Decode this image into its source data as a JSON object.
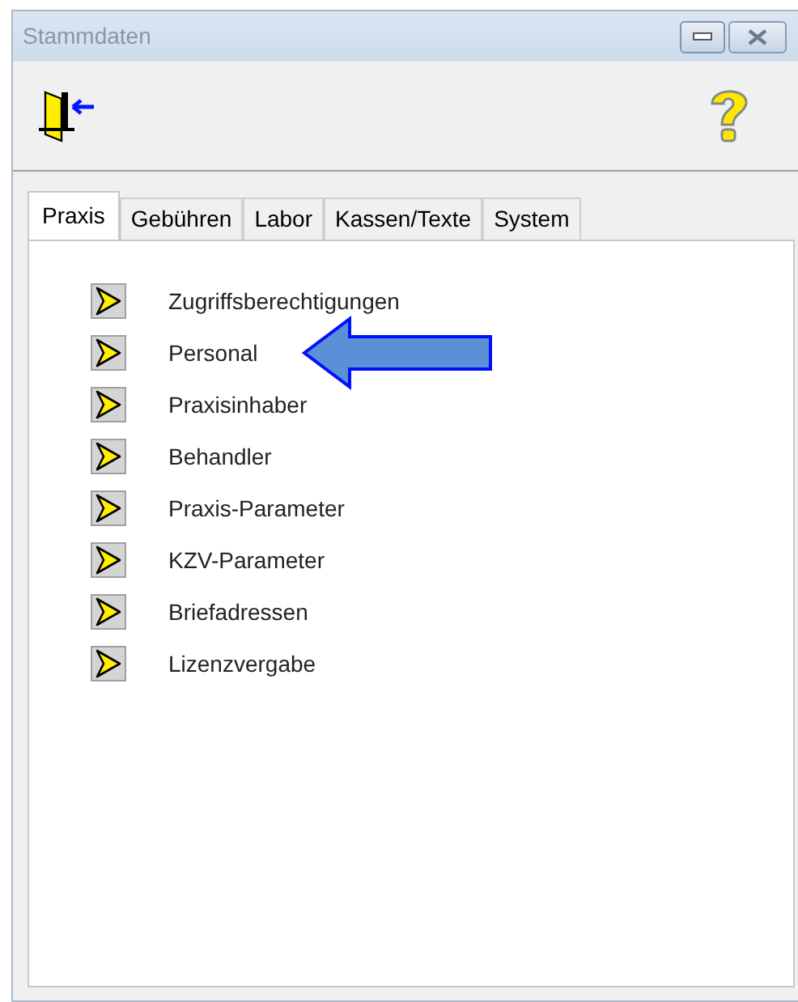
{
  "window": {
    "title": "Stammdaten"
  },
  "tabs": [
    {
      "label": "Praxis",
      "selected": true
    },
    {
      "label": "Gebühren",
      "selected": false
    },
    {
      "label": "Labor",
      "selected": false
    },
    {
      "label": "Kassen/Texte",
      "selected": false
    },
    {
      "label": "System",
      "selected": false
    }
  ],
  "items": [
    {
      "label": "Zugriffsberechtigungen",
      "highlighted": false
    },
    {
      "label": "Personal",
      "highlighted": true
    },
    {
      "label": "Praxisinhaber",
      "highlighted": false
    },
    {
      "label": "Behandler",
      "highlighted": false
    },
    {
      "label": "Praxis-Parameter",
      "highlighted": false
    },
    {
      "label": "KZV-Parameter",
      "highlighted": false
    },
    {
      "label": "Briefadressen",
      "highlighted": false
    },
    {
      "label": "Lizenzvergabe",
      "highlighted": false
    }
  ]
}
